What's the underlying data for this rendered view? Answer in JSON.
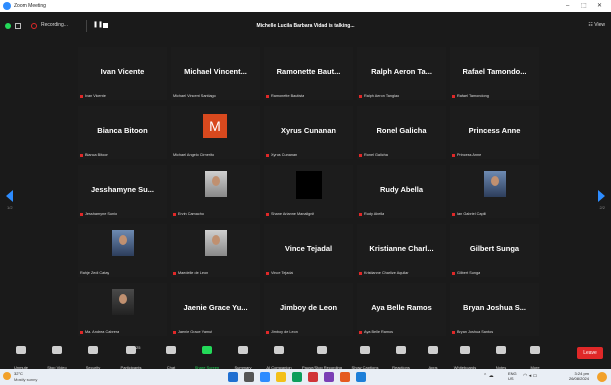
{
  "titlebar": {
    "title": "Zoom Meeting",
    "min": "–",
    "max": "⬚",
    "close": "✕"
  },
  "topbar": {
    "recording_label": "Recording...",
    "pause": "❚❚",
    "speaker": "Michelle Lucila Barbara Vidad is talking...",
    "view_label": "☷ View"
  },
  "colors": {
    "accent": "#2d8cff",
    "leave": "#e02828",
    "share": "#23d959",
    "avatar_m": "#d8491e"
  },
  "tiles": [
    {
      "name": "Ivan Vicente",
      "caption": "Ivan Vicente"
    },
    {
      "name": "Michael Vincent...",
      "caption": "Michael Vincent Santiago"
    },
    {
      "name": "Ramonette Baut...",
      "caption": "Ramonette Bautista"
    },
    {
      "name": "Ralph Aeron Ta...",
      "caption": "Ralph Aeron Tanglao"
    },
    {
      "name": "Rafael Tamondo...",
      "caption": "Rafael Tamondong"
    },
    {
      "name": "Bianca Bitoon",
      "caption": "Bianca Bitoon"
    },
    {
      "name": "",
      "caption": "Michael Angelo Cirnerito",
      "avatar_letter": "M"
    },
    {
      "name": "Xyrus Cunanan",
      "caption": "Xyrus Cunanan"
    },
    {
      "name": "Ronel Galicha",
      "caption": "Ronel Galicha"
    },
    {
      "name": "Princess Anne",
      "caption": "Princess Anne"
    },
    {
      "name": "Jesshamyne Su...",
      "caption": "Jesshamyne Sunio"
    },
    {
      "name": "",
      "caption": "Ervin Camacho"
    },
    {
      "name": "",
      "caption": "Shane Arianne Manalignit"
    },
    {
      "name": "Rudy Abella",
      "caption": "Rudy Abella"
    },
    {
      "name": "",
      "caption": "Ian Gabriel Capili"
    },
    {
      "name": "",
      "caption": "Rahje Zedi Catay"
    },
    {
      "name": "",
      "caption": "Maedelle de Leon"
    },
    {
      "name": "Vince Tejadal",
      "caption": "Vince Tejadal"
    },
    {
      "name": "Kristianne Charl...",
      "caption": "Kristianne Charlize Aquilar"
    },
    {
      "name": "Gilbert Sunga",
      "caption": "Gilbert Sunga"
    },
    {
      "name": "",
      "caption": "Ma. Andrea Cabrera"
    },
    {
      "name": "Jaenie Grace Yu...",
      "caption": "Jaenie Grace Yamut"
    },
    {
      "name": "Jimboy de Leon",
      "caption": "Jimboy de Leon"
    },
    {
      "name": "Aya Belle Ramos",
      "caption": "Aya Belle Ramos"
    },
    {
      "name": "Bryan Joshua S...",
      "caption": "Bryan Joshua Santos"
    }
  ],
  "pager": {
    "left": "1/2",
    "right": "2/2"
  },
  "toolbar": {
    "unmute": "Unmute",
    "stop_video": "Stop Video",
    "security": "Security",
    "participants": "Participants",
    "participant_count": "25",
    "chat": "Chat",
    "share_screen": "Share Screen",
    "summary": "Summary",
    "ai_companion": "AI Companion",
    "pause_recording": "Pause/Stop Recording",
    "show_captions": "Show Captions",
    "reactions": "Reactions",
    "apps": "Apps",
    "whiteboards": "Whiteboards",
    "notes": "Notes",
    "more": "More",
    "leave": "Leave"
  },
  "taskbar": {
    "temp": "32°C",
    "weather": "Mostly sunny",
    "lang": "ENG",
    "region": "US",
    "time": "3:24 pm",
    "date": "26/08/2024"
  }
}
